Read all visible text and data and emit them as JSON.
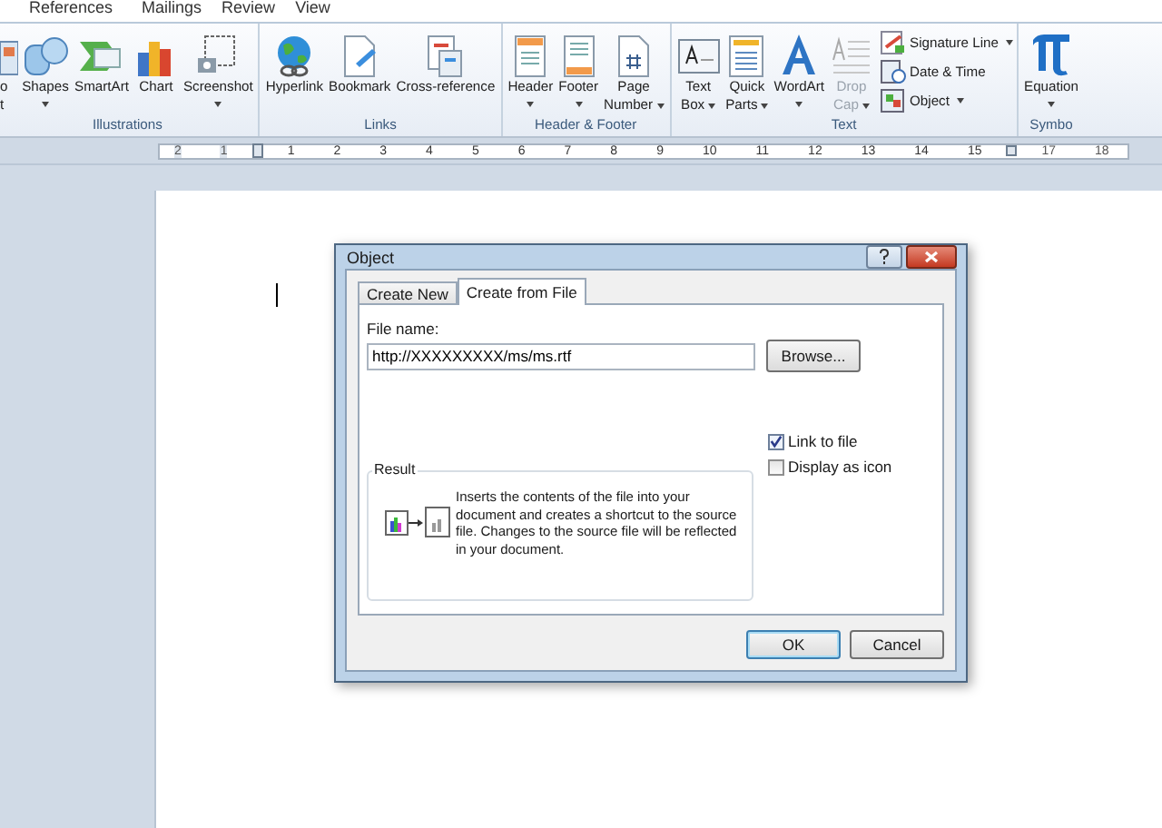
{
  "ribbon_tabs": [
    {
      "label": "References",
      "selected": false
    },
    {
      "label": "Mailings",
      "selected": false
    },
    {
      "label": "Review",
      "selected": false
    },
    {
      "label": "View",
      "selected": false
    }
  ],
  "ribbon_groups": [
    {
      "label": "Illustrations",
      "items": [
        {
          "kind": "large",
          "lines": [
            "o",
            "t"
          ],
          "caret_below": false,
          "caret_inline": false,
          "disabled": false
        },
        {
          "kind": "large",
          "lines": [
            "Shapes"
          ],
          "caret_below": true,
          "caret_inline": false,
          "disabled": false
        },
        {
          "kind": "large",
          "lines": [
            "SmartArt"
          ],
          "caret_below": false,
          "caret_inline": false,
          "disabled": false
        },
        {
          "kind": "large",
          "lines": [
            "Chart"
          ],
          "caret_below": false,
          "caret_inline": false,
          "disabled": false
        },
        {
          "kind": "large",
          "lines": [
            "Screenshot"
          ],
          "caret_below": true,
          "caret_inline": false,
          "disabled": false
        }
      ]
    },
    {
      "label": "Links",
      "items": [
        {
          "kind": "large",
          "lines": [
            "Hyperlink"
          ],
          "caret_below": false,
          "caret_inline": false,
          "disabled": false
        },
        {
          "kind": "large",
          "lines": [
            "Bookmark"
          ],
          "caret_below": false,
          "caret_inline": false,
          "disabled": false
        },
        {
          "kind": "large",
          "lines": [
            "Cross-reference"
          ],
          "caret_below": false,
          "caret_inline": false,
          "disabled": false
        }
      ]
    },
    {
      "label": "Header & Footer",
      "items": [
        {
          "kind": "large",
          "lines": [
            "Header"
          ],
          "caret_below": true,
          "caret_inline": false,
          "disabled": false
        },
        {
          "kind": "large",
          "lines": [
            "Footer"
          ],
          "caret_below": true,
          "caret_inline": false,
          "disabled": false
        },
        {
          "kind": "large",
          "lines": [
            "Page",
            "Number"
          ],
          "caret_below": false,
          "caret_inline": true,
          "disabled": false
        }
      ]
    },
    {
      "label": "Text",
      "items": [
        {
          "kind": "large",
          "lines": [
            "Text",
            "Box"
          ],
          "caret_below": false,
          "caret_inline": true,
          "disabled": false
        },
        {
          "kind": "large",
          "lines": [
            "Quick",
            "Parts"
          ],
          "caret_below": false,
          "caret_inline": true,
          "disabled": false
        },
        {
          "kind": "large",
          "lines": [
            "WordArt"
          ],
          "caret_below": true,
          "caret_inline": false,
          "disabled": false
        },
        {
          "kind": "large",
          "lines": [
            "Drop",
            "Cap"
          ],
          "caret_below": false,
          "caret_inline": true,
          "disabled": true
        },
        {
          "kind": "stack",
          "entries": [
            {
              "label": "Signature Line",
              "caret_inline": true
            },
            {
              "label": "Date & Time",
              "caret_inline": false
            },
            {
              "label": "Object",
              "caret_inline": true
            }
          ]
        }
      ]
    },
    {
      "label": "Symbo",
      "items": [
        {
          "kind": "large",
          "lines": [
            "Equation"
          ],
          "caret_below": true,
          "caret_inline": false,
          "disabled": false
        }
      ]
    }
  ],
  "ruler": {
    "left_labels": [
      "2",
      "1"
    ],
    "right_labels": [
      "1",
      "2",
      "3",
      "4",
      "5",
      "6",
      "7",
      "8",
      "9",
      "10",
      "11",
      "12",
      "13",
      "14",
      "15"
    ],
    "after_marker_labels": [
      "17",
      "18"
    ]
  },
  "dialog": {
    "title": "Object",
    "tabs": [
      {
        "label": "Create New",
        "selected": false
      },
      {
        "label": "Create from File",
        "selected": true
      }
    ],
    "file_name_label": "File name:",
    "file_name_value": "http://XXXXXXXXX/ms/ms.rtf",
    "browse_button": "Browse...",
    "options": [
      {
        "label": "Link to file",
        "checked": true
      },
      {
        "label": "Display as icon",
        "checked": false
      }
    ],
    "result_title": "Result",
    "result_text": "Inserts the contents of the file into your document and creates a shortcut to the source file.  Changes to the source file will be reflected in your document.",
    "buttons": [
      "OK",
      "Cancel"
    ]
  }
}
